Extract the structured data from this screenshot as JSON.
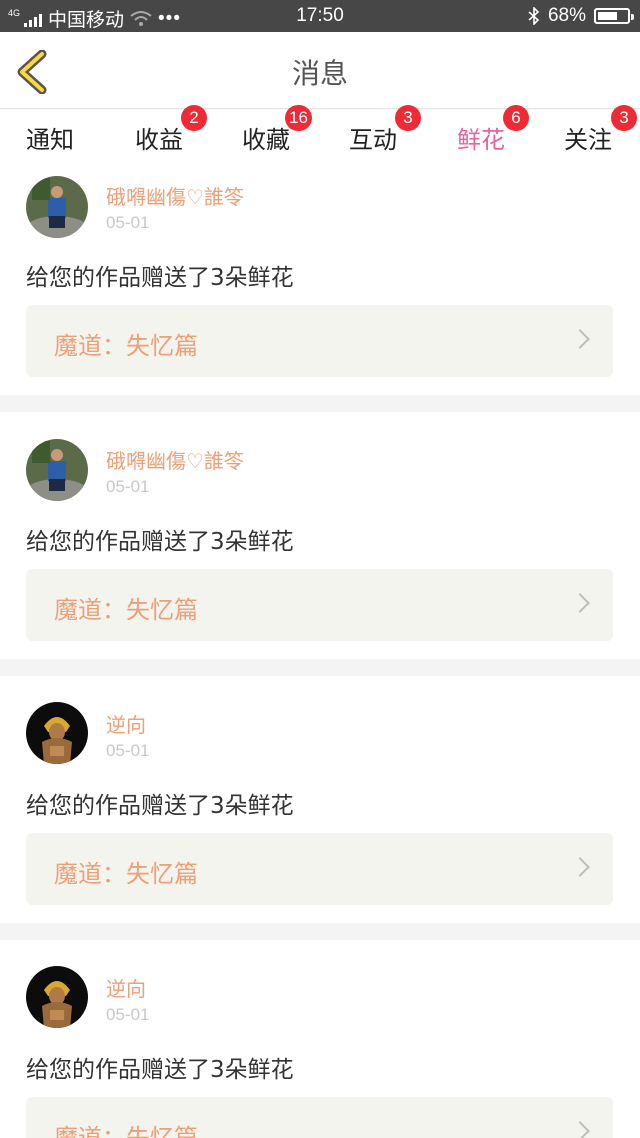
{
  "status_bar": {
    "network": "4G",
    "carrier": "中国移动",
    "time": "17:50",
    "battery": "68%",
    "battery_level": 0.68
  },
  "header": {
    "title": "消息"
  },
  "tabs": [
    {
      "label": "通知",
      "badge": null
    },
    {
      "label": "收益",
      "badge": "2"
    },
    {
      "label": "收藏",
      "badge": "16"
    },
    {
      "label": "互动",
      "badge": "3"
    },
    {
      "label": "鲜花",
      "badge": "6"
    },
    {
      "label": "关注",
      "badge": "3"
    }
  ],
  "active_tab": "鲜花",
  "colors": {
    "accent_pink": "#e862a0",
    "badge_red": "#ee2a34",
    "name_orange": "#eda077"
  },
  "messages": [
    {
      "user": "硪嘚幽傷♡誰笭",
      "date": "05-01",
      "text": "给您的作品赠送了3朵鲜花",
      "work": "魔道：失忆篇"
    },
    {
      "user": "硪嘚幽傷♡誰笭",
      "date": "05-01",
      "text": "给您的作品赠送了3朵鲜花",
      "work": "魔道：失忆篇"
    },
    {
      "user": "逆向",
      "date": "05-01",
      "text": "给您的作品赠送了3朵鲜花",
      "work": "魔道：失忆篇"
    },
    {
      "user": "逆向",
      "date": "05-01",
      "text": "给您的作品赠送了3朵鲜花",
      "work": "魔道：失忆篇"
    }
  ]
}
